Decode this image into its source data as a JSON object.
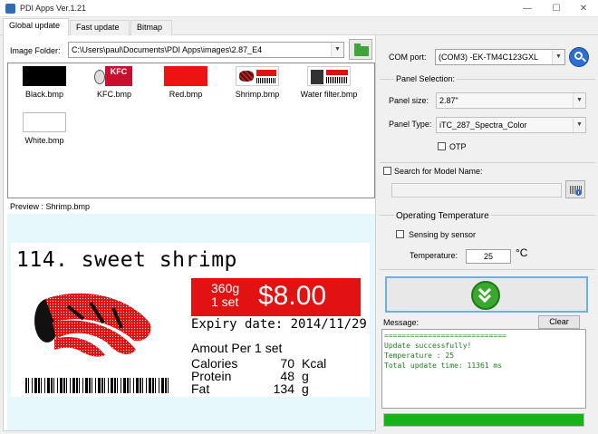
{
  "window": {
    "title": "PDI Apps Ver.1.21",
    "minimize": "—",
    "maximize": "☐",
    "close": "✕"
  },
  "tabs": [
    "Global update",
    "Fast update",
    "Bitmap"
  ],
  "left": {
    "folder_label": "Image Folder:",
    "folder_path": "C:\\Users\\paul\\Documents\\PDI Apps\\images\\2.87_E4",
    "images": [
      {
        "name": "Black.bmp",
        "kind": "black"
      },
      {
        "name": "KFC.bmp",
        "kind": "kfc",
        "logo_text": "KFC"
      },
      {
        "name": "Red.bmp",
        "kind": "red"
      },
      {
        "name": "Shrimp.bmp",
        "kind": "shrimp"
      },
      {
        "name": "Water filter.bmp",
        "kind": "water"
      },
      {
        "name": "White.bmp",
        "kind": "white"
      }
    ],
    "preview_label": "Preview : Shrimp.bmp",
    "preview": {
      "product": "114. sweet shrimp",
      "qty_line1": "360g",
      "qty_line2": "1 set",
      "price": "$8.00",
      "expiry": "Expiry date: 2014/11/29",
      "amount_per": "Amout Per 1 set",
      "nutrition": [
        {
          "label": "Calories",
          "value": "70",
          "unit": "Kcal"
        },
        {
          "label": "Protein",
          "value": "48",
          "unit": "g"
        },
        {
          "label": "Fat",
          "value": "134",
          "unit": "g"
        }
      ]
    }
  },
  "right": {
    "com_label": "COM port:",
    "com_value": "(COM3) -EK-TM4C123GXL",
    "panel_selection": "Panel Selection:",
    "panel_size_label": "Panel size:",
    "panel_size_value": "2.87\"",
    "panel_type_label": "Panel Type:",
    "panel_type_value": "iTC_287_Spectra_Color",
    "otp_label": "OTP",
    "search_label": "Search for Model Name:",
    "op_temp_title": "Operating Temperature",
    "sensing_label": "Sensing by sensor",
    "temperature_label": "Temperature:",
    "temperature_value": "25",
    "temperature_unit": "°C",
    "message_label": "Message:",
    "clear_label": "Clear",
    "messages": [
      "============================",
      "Update successfully!",
      "Temperature : 25",
      "Total update time: 11361 ms"
    ],
    "progress": 1.0,
    "progress_color": "#16b316"
  }
}
